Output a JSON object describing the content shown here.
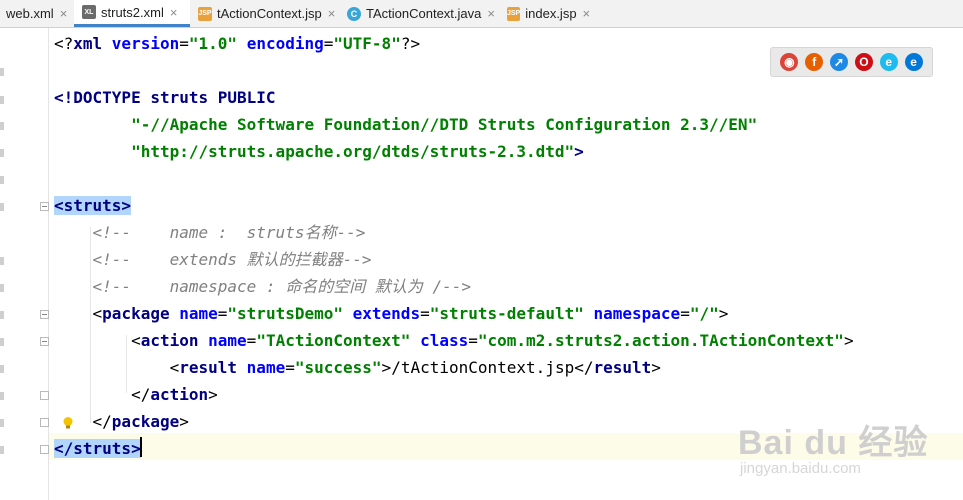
{
  "tabs": [
    {
      "label": "web.xml",
      "icon": "xml-file-icon",
      "active": false
    },
    {
      "label": "struts2.xml",
      "icon": "xml-file-icon",
      "active": true
    },
    {
      "label": "tActionContext.jsp",
      "icon": "jsp-file-icon",
      "active": false
    },
    {
      "label": "TActionContext.java",
      "icon": "java-class-icon",
      "active": false
    },
    {
      "label": "index.jsp",
      "icon": "jsp-file-icon",
      "active": false
    }
  ],
  "tab_close_glyph": "×",
  "browsers": [
    "chrome-icon",
    "firefox-icon",
    "safari-icon",
    "opera-icon",
    "ie-icon",
    "edge-icon"
  ],
  "code_lines": [
    [
      [
        "punct",
        "<?"
      ],
      [
        "tag",
        "xml "
      ],
      [
        "attr",
        "version"
      ],
      [
        "punct",
        "="
      ],
      [
        "val",
        "\"1.0\""
      ],
      [
        "text",
        " "
      ],
      [
        "attr",
        "encoding"
      ],
      [
        "punct",
        "="
      ],
      [
        "val",
        "\"UTF-8\""
      ],
      [
        "punct",
        "?>"
      ]
    ],
    [],
    [
      [
        "doctype",
        "<!DOCTYPE struts PUBLIC"
      ]
    ],
    [
      [
        "text",
        "        "
      ],
      [
        "val",
        "\"-//Apache Software Foundation//DTD Struts Configuration 2.3//EN\""
      ]
    ],
    [
      [
        "text",
        "        "
      ],
      [
        "val",
        "\"http://struts.apache.org/dtds/struts-2.3.dtd\""
      ],
      [
        "doctype",
        ">"
      ]
    ],
    [],
    [
      [
        "hl-tag",
        "<struts>"
      ]
    ],
    [
      [
        "text",
        "    "
      ],
      [
        "comment",
        "<!--    name :  struts名称-->"
      ]
    ],
    [
      [
        "text",
        "    "
      ],
      [
        "comment",
        "<!--    extends 默认的拦截器-->"
      ]
    ],
    [
      [
        "text",
        "    "
      ],
      [
        "comment",
        "<!--    namespace : 命名的空间 默认为 /-->"
      ]
    ],
    [
      [
        "text",
        "    "
      ],
      [
        "punct",
        "<"
      ],
      [
        "tag",
        "package "
      ],
      [
        "attr",
        "name"
      ],
      [
        "punct",
        "="
      ],
      [
        "val",
        "\"strutsDemo\""
      ],
      [
        "text",
        " "
      ],
      [
        "attr",
        "extends"
      ],
      [
        "punct",
        "="
      ],
      [
        "val",
        "\"struts-default\""
      ],
      [
        "text",
        " "
      ],
      [
        "attr",
        "namespace"
      ],
      [
        "punct",
        "="
      ],
      [
        "val",
        "\"/\""
      ],
      [
        "punct",
        ">"
      ]
    ],
    [
      [
        "text",
        "        "
      ],
      [
        "punct",
        "<"
      ],
      [
        "tag",
        "action "
      ],
      [
        "attr",
        "name"
      ],
      [
        "punct",
        "="
      ],
      [
        "val",
        "\"TActionContext\""
      ],
      [
        "text",
        " "
      ],
      [
        "attr",
        "class"
      ],
      [
        "punct",
        "="
      ],
      [
        "val",
        "\"com.m2.struts2.action.TActionContext\""
      ],
      [
        "punct",
        ">"
      ]
    ],
    [
      [
        "text",
        "            "
      ],
      [
        "punct",
        "<"
      ],
      [
        "tag",
        "result "
      ],
      [
        "attr",
        "name"
      ],
      [
        "punct",
        "="
      ],
      [
        "val",
        "\"success\""
      ],
      [
        "punct",
        ">"
      ],
      [
        "text",
        "/tActionContext.jsp"
      ],
      [
        "punct",
        "</"
      ],
      [
        "tag",
        "result"
      ],
      [
        "punct",
        ">"
      ]
    ],
    [
      [
        "text",
        "        "
      ],
      [
        "punct",
        "</"
      ],
      [
        "tag",
        "action"
      ],
      [
        "punct",
        ">"
      ]
    ],
    [
      [
        "text",
        "    "
      ],
      [
        "punct",
        "</"
      ],
      [
        "tag",
        "package"
      ],
      [
        "punct",
        ">"
      ]
    ],
    [
      [
        "hl-tag",
        "</struts>"
      ]
    ]
  ],
  "watermark": {
    "brand": "Bai du 经验",
    "url": "jingyan.baidu.com"
  },
  "colors": {
    "active_tab_underline": "#4083c9",
    "tag": "#000080",
    "attr": "#0000ff",
    "value": "#008000",
    "comment": "#808080",
    "highlight": "#b2d5fb"
  }
}
